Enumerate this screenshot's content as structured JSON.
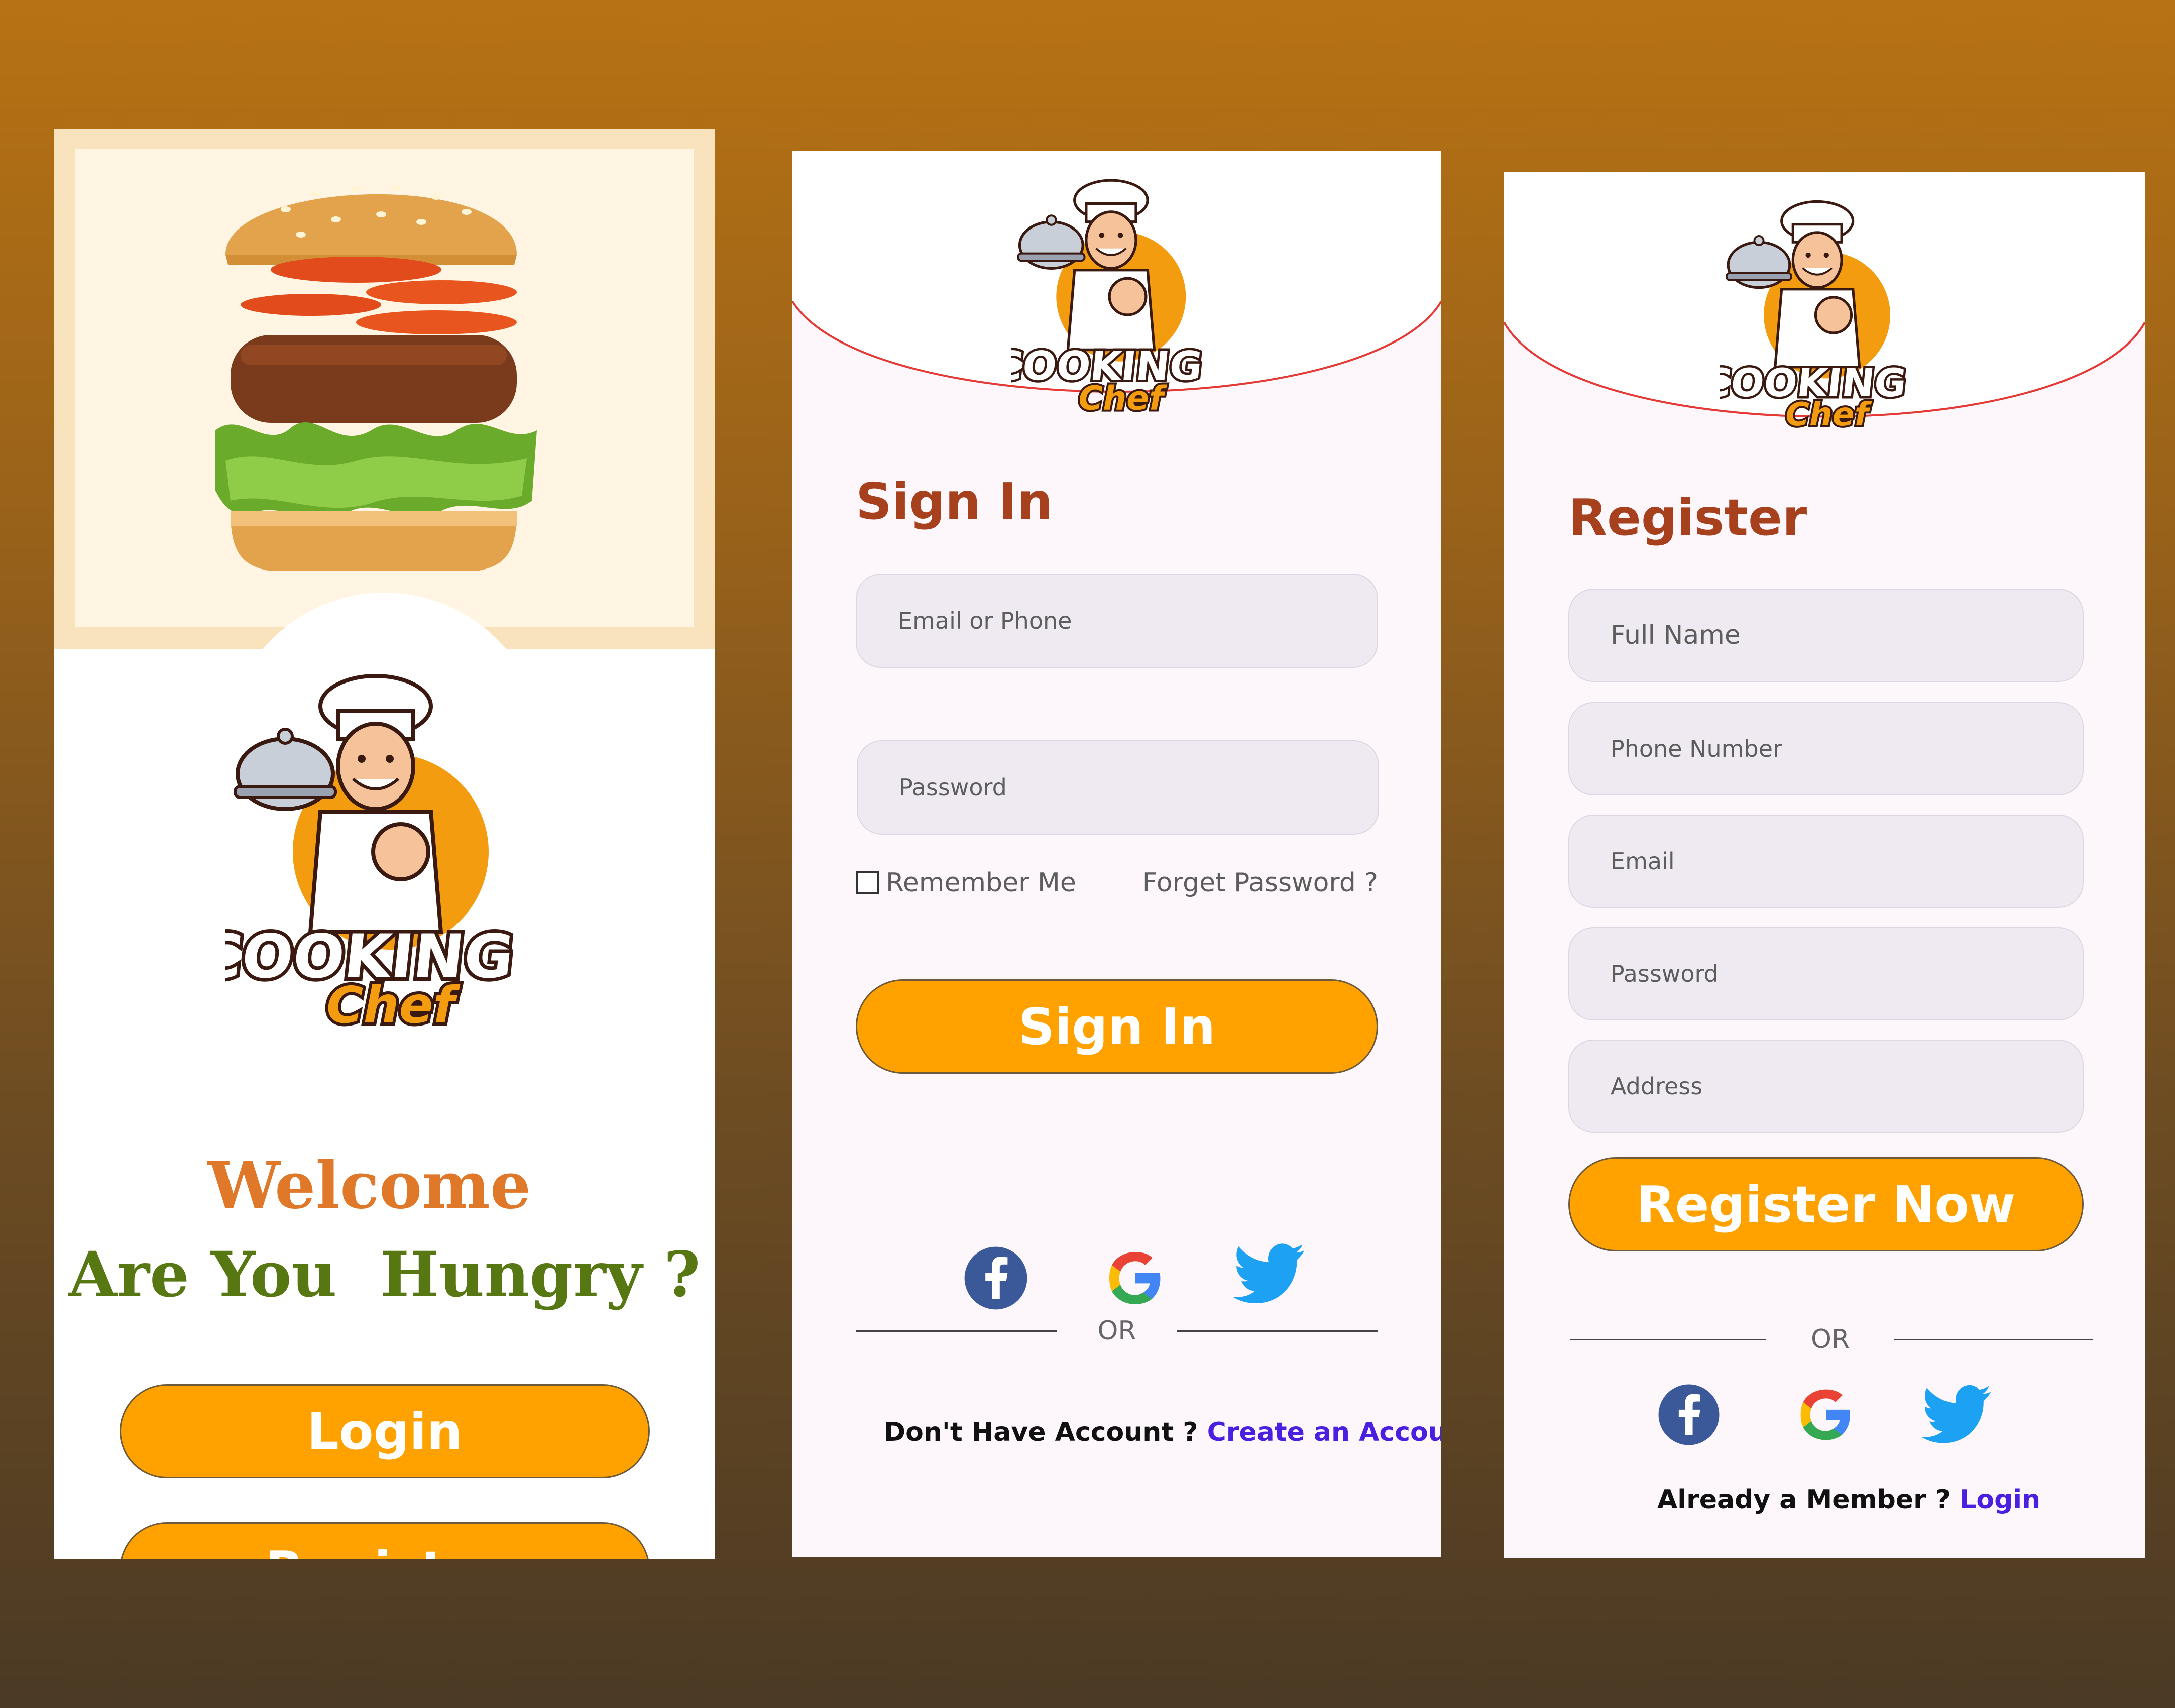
{
  "welcome": {
    "logo": {
      "word1": "COOKING",
      "word2": "Chef"
    },
    "title": "Welcome",
    "subtitle": "Are You  Hungry ?",
    "login_label": "Login",
    "register_label": "Register"
  },
  "signin": {
    "logo": {
      "word1": "COOKING",
      "word2": "Chef"
    },
    "title": "Sign In",
    "email_placeholder": "Email or Phone",
    "password_placeholder": "Password",
    "remember_label": "Remember Me",
    "forgot_label": "Forget Password ?",
    "submit_label": "Sign In",
    "or_label": "OR",
    "footer_text": "Don't Have Account ? ",
    "footer_link": "Create an Account"
  },
  "register": {
    "logo": {
      "word1": "COOKING",
      "word2": "Chef"
    },
    "title": "Register",
    "fields": [
      "Full Name",
      "Phone Number",
      "Email",
      "Password",
      "Address"
    ],
    "submit_label": "Register Now",
    "or_label": "OR",
    "footer_text": "Already a Member ? ",
    "footer_link": "Login"
  },
  "social_icons": [
    "facebook-icon",
    "google-icon",
    "twitter-icon"
  ],
  "colors": {
    "accent_orange": "#ffa200",
    "title_brown": "#a7401d",
    "welcome_orange": "#e0782a",
    "hungry_green": "#567712",
    "link_purple": "#4a1fe0",
    "field_bg": "#efe9f2"
  }
}
